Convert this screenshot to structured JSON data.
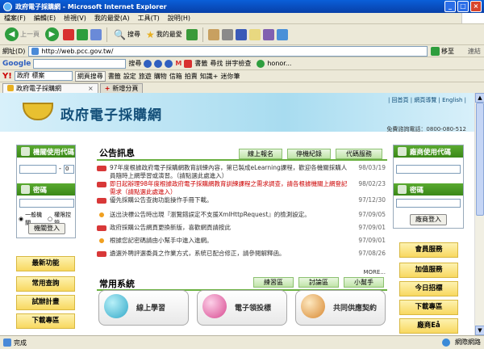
{
  "window": {
    "title": "政府電子採購網 - Microsoft Internet Explorer"
  },
  "menu": [
    "檔案(F)",
    "編輯(E)",
    "檢視(V)",
    "我的最愛(A)",
    "工具(T)",
    "說明(H)"
  ],
  "toolbar": {
    "back_label": "上一頁",
    "search_label": "搜尋",
    "favorites_label": "我的最愛"
  },
  "address": {
    "label": "網址(D)",
    "url": "http://web.pcc.gov.tw/",
    "go_label": "移至",
    "links_label": "連結"
  },
  "googlebar": {
    "brand": "Google",
    "search_label": "搜尋",
    "items": [
      "書籤",
      "尋找",
      "拼字檢查"
    ],
    "account": "honor..."
  },
  "yahoobar": {
    "search_value": "政府 標案",
    "items": [
      "網頁搜尋",
      "書籤",
      "設定",
      "旅遊",
      "購物",
      "信箱",
      "拍賣",
      "知識+",
      "迷你筆"
    ]
  },
  "tabs": {
    "active": "政府電子採購網",
    "new_tab": "新增分頁"
  },
  "site": {
    "title": "政府電子採購網",
    "toplinks": "| 回首頁 | 網頁導覽 | English |",
    "hotline": "免費諮詢電話：0800-080-512"
  },
  "left": {
    "agency_code_head": "機關使用代碼",
    "code_sep": "-",
    "code_suffix": "0",
    "password_head": "密碼",
    "radio_general": "一般機關",
    "radio_control": "權限控管",
    "login": "機關登入",
    "nav": [
      "最新功能",
      "常用查詢",
      "試辦計畫",
      "下載專區"
    ]
  },
  "right": {
    "vendor_code_head": "廠商使用代碼",
    "password_head": "密碼",
    "login": "廠商登入",
    "nav": [
      "會員服務",
      "加值服務",
      "今日招標",
      "下載專區",
      "廠商Eå"
    ]
  },
  "news": {
    "title": "公告訊息",
    "buttons": [
      "線上報名",
      "停機紀錄",
      "代碼服務"
    ],
    "items": [
      {
        "text": "97年度根據政府電子採購網教育訓練內容，第已製成eLearning課程，歡迎各機關採購人員隨時上網學習或演習。（請點選此處進入）",
        "date": "98/03/19",
        "kind": "bar",
        "red": false
      },
      {
        "text": "即日起辦理98年度根據政府電子採購網教育訓練課程之需求調查，請各根據機關上網登記需求（請點選此處進入）",
        "date": "98/02/23",
        "kind": "bar",
        "red": true
      },
      {
        "text": "優先採購公告查詢功能操作手冊下載。",
        "date": "97/12/30",
        "kind": "bar",
        "red": false
      },
      {
        "text": "送出決標公告時出現『瀏覽錯誤定不支援XmlHttpRequest』的檢測設定。",
        "date": "97/09/05",
        "kind": "star",
        "red": false
      },
      {
        "text": "政府採購公告網頁更換新版，喜歡網頁請按此",
        "date": "97/09/01",
        "kind": "bar",
        "red": false
      },
      {
        "text": "根據您記密碼請由小幫手中進入進網。",
        "date": "97/09/01",
        "kind": "star",
        "red": false
      },
      {
        "text": "遴選外聘評選委員之作業方式，系統已配合修正，請參閱解釋函。",
        "date": "97/08/26",
        "kind": "bar",
        "red": false
      }
    ],
    "more": "MORE..."
  },
  "systems": {
    "title": "常用系統",
    "buttons": [
      "練習區",
      "討論區",
      "小幫手"
    ],
    "items": [
      "線上學習",
      "電子領投標",
      "共同供應契約"
    ]
  },
  "status": {
    "text": "完成",
    "zone": "網際網路"
  },
  "colors": {
    "title_bar": "#0a5fd8",
    "green_head": "#4a9a24",
    "yellow_btn": "#f8d860",
    "news_red": "#cc0000"
  }
}
